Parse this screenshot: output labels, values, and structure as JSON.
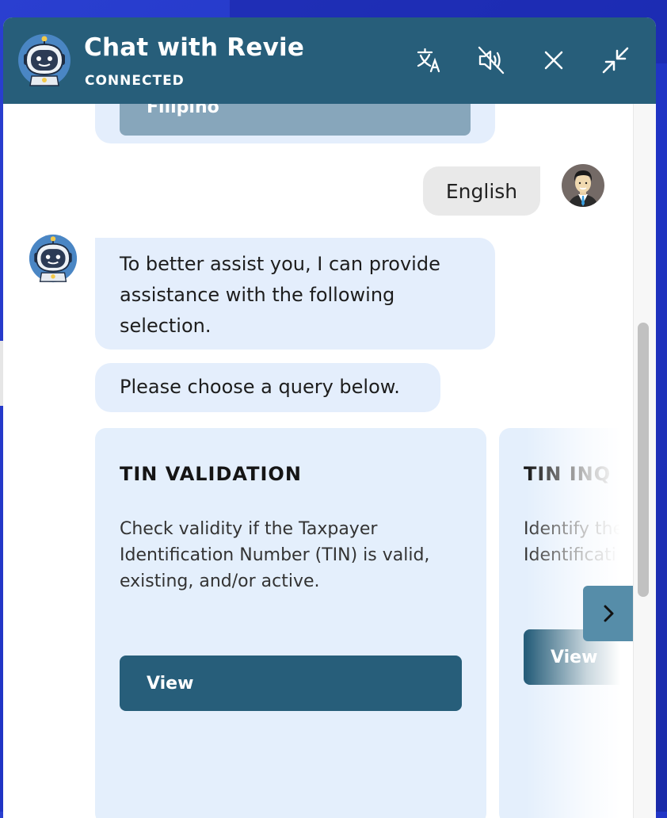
{
  "header": {
    "title": "Chat with Revie",
    "status": "CONNECTED",
    "icons": [
      "translate-icon",
      "sound-muted-icon",
      "close-icon",
      "minimize-icon"
    ]
  },
  "messages": {
    "previous_option": "Filipino",
    "user_reply": "English",
    "bot_message_1": "To better assist you, I can provide assistance with the following selection.",
    "bot_message_2": "Please choose a query below."
  },
  "cards": [
    {
      "title": "TIN VALIDATION",
      "description": "Check validity if the Taxpayer Identification Number (TIN) is valid, existing, and/or active.",
      "button": "View"
    },
    {
      "title": "TIN INQ",
      "description": "Identify the Identificati",
      "button": "View"
    }
  ],
  "carousel": {
    "next_icon": "chevron-right-icon"
  },
  "colors": {
    "header_bg": "#275e7a",
    "bubble_bg": "#e4eefc",
    "user_bubble_bg": "#e9e9e9",
    "button_bg": "#275e7a",
    "next_button_bg": "#568da9",
    "page_bg": "#2a3fd0"
  }
}
